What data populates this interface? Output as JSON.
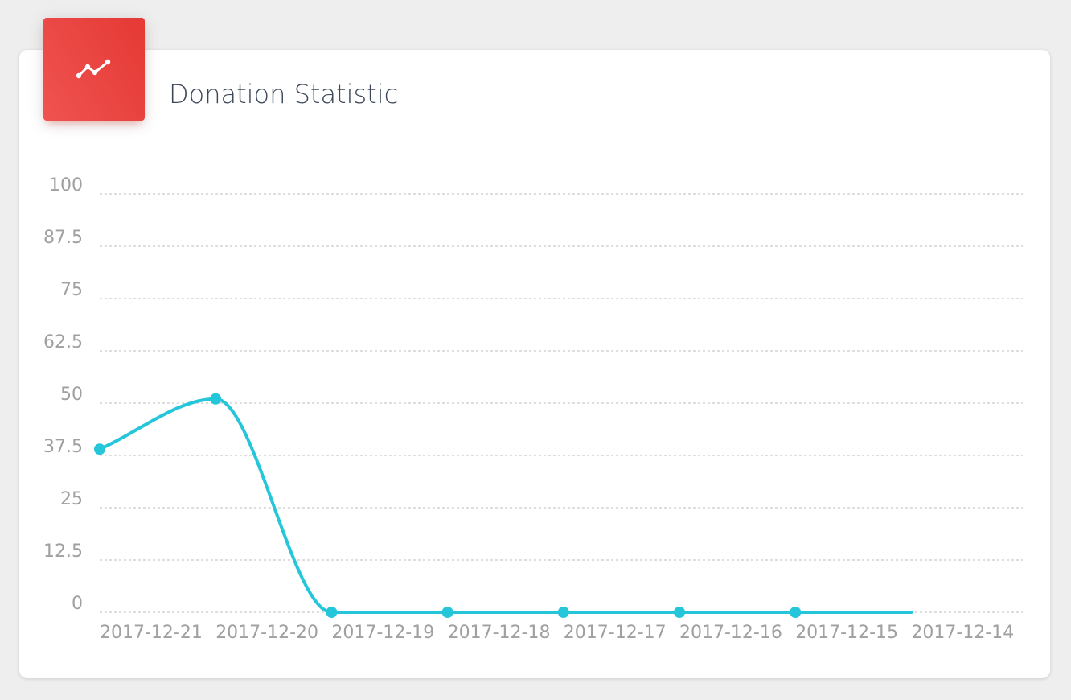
{
  "card": {
    "title": "Donation Statistic",
    "icon": "line-chart-icon",
    "icon_color": "#ffffff",
    "header_color": "#e53935"
  },
  "chart_data": {
    "type": "line",
    "x": [
      "2017-12-21",
      "2017-12-20",
      "2017-12-19",
      "2017-12-18",
      "2017-12-17",
      "2017-12-16",
      "2017-12-15",
      "2017-12-14"
    ],
    "series": [
      {
        "values": [
          39,
          51,
          0,
          0,
          0,
          0,
          0,
          0
        ],
        "color": "#26c6da"
      }
    ],
    "y_ticks": [
      "0",
      "12.5",
      "25",
      "37.5",
      "50",
      "62.5",
      "75",
      "87.5",
      "100"
    ],
    "ylim": [
      0,
      100
    ],
    "grid": true,
    "grid_style": "dashed",
    "smooth": true,
    "title": "Donation Statistic"
  }
}
